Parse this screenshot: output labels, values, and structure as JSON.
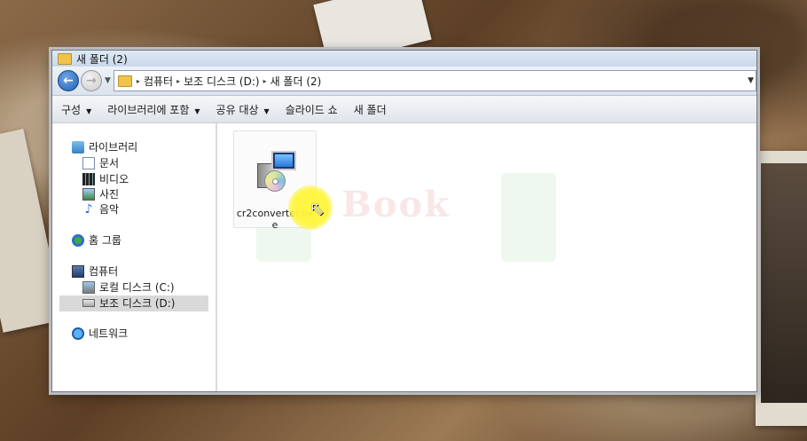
{
  "window": {
    "title": "새 폴더 (2)"
  },
  "address": {
    "crumbs": [
      "컴퓨터",
      "보조 디스크 (D:)",
      "새 폴더 (2)"
    ]
  },
  "toolbar": {
    "organize": "구성",
    "include_library": "라이브러리에 포함",
    "share": "공유 대상",
    "slideshow": "슬라이드 쇼",
    "new_folder": "새 폴더"
  },
  "nav": {
    "libraries": "라이브러리",
    "documents": "문서",
    "videos": "비디오",
    "pictures": "사진",
    "music": "음악",
    "homegroup": "홈 그룹",
    "computer": "컴퓨터",
    "local_disk": "로컬 디스크 (C:)",
    "aux_disk": "보조 디스크 (D:)",
    "network": "네트워크"
  },
  "files": [
    {
      "name": "cr2converter.exe",
      "icon": "installer-icon"
    }
  ],
  "watermark": "Book"
}
